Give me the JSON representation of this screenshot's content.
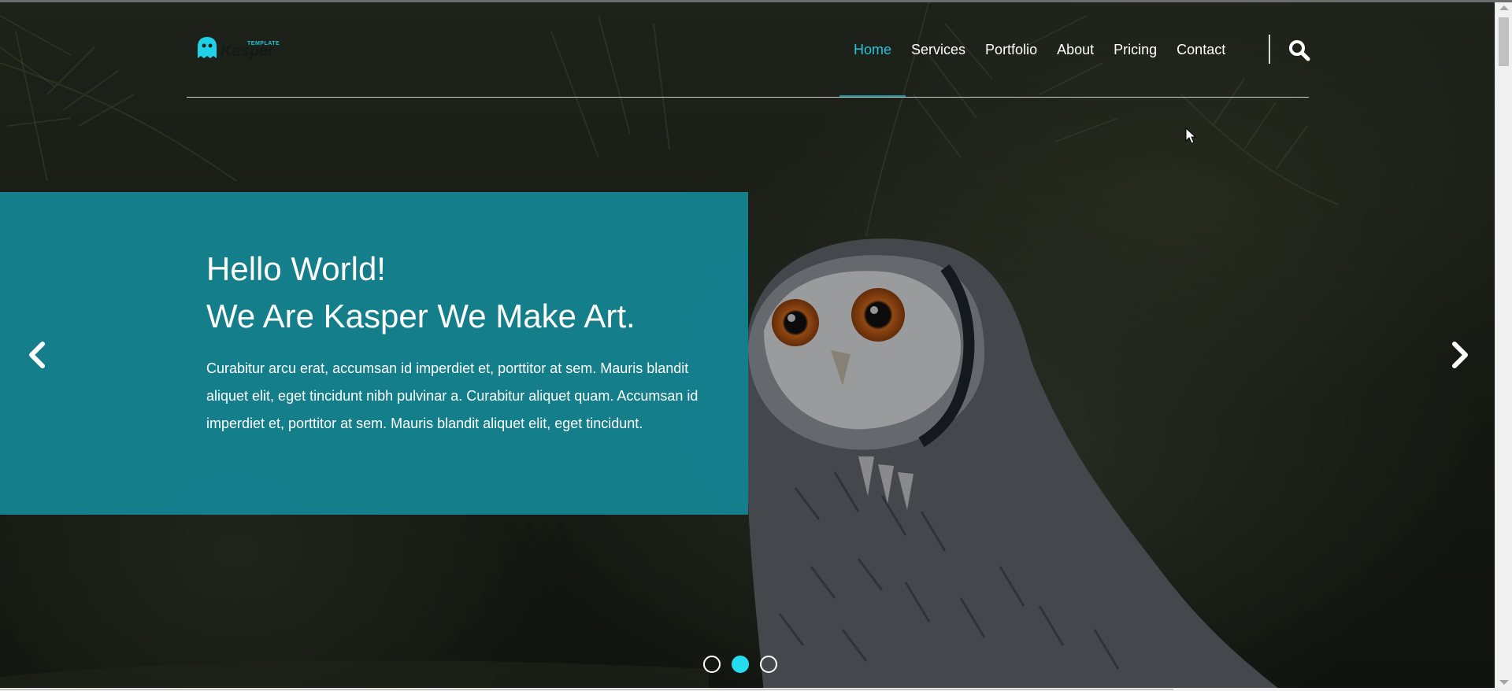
{
  "brand": {
    "tagline": "TEMPLATE",
    "name": "Kasper"
  },
  "nav": {
    "items": [
      {
        "label": "Home",
        "active": true
      },
      {
        "label": "Services"
      },
      {
        "label": "Portfolio"
      },
      {
        "label": "About"
      },
      {
        "label": "Pricing"
      },
      {
        "label": "Contact"
      }
    ],
    "search_icon": "search-icon"
  },
  "hero": {
    "title_line1": "Hello World!",
    "title_line2": "We Are Kasper We Make Art.",
    "body": "Curabitur arcu erat, accumsan id imperdiet et, porttitor at sem. Mauris blandit aliquet elit, eget tincidunt nibh pulvinar a. Curabitur aliquet quam. Accumsan id imperdiet et, porttitor at sem. Mauris blandit aliquet elit, eget tincidunt.",
    "prev_icon": "chevron-left-icon",
    "next_icon": "chevron-right-icon",
    "slides": 3,
    "active_slide": 2
  },
  "colors": {
    "accent": "#23c3dc",
    "caption_bg": "#158796",
    "active_dot": "#26dcef"
  }
}
